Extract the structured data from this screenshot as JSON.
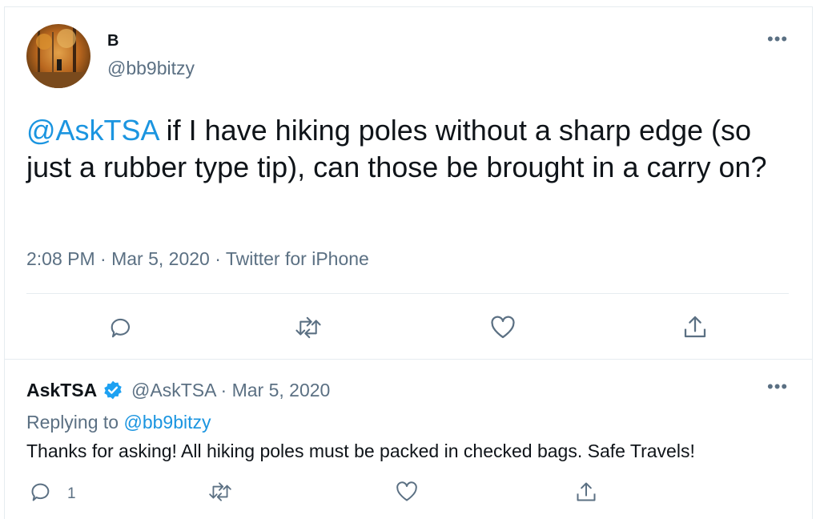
{
  "tweet": {
    "display_name": "B",
    "handle": "@bb9bitzy",
    "mention": "@AskTSA",
    "text": " if I have hiking poles without a sharp edge (so just a rubber type tip), can those be brought in a carry on?",
    "timestamp": "2:08 PM · Mar 5, 2020 · Twitter for iPhone",
    "more_icon": "more-horizontal-icon",
    "actions": [
      "reply-icon",
      "retweet-icon",
      "like-icon",
      "share-icon"
    ]
  },
  "reply": {
    "display_name": "AskTSA",
    "handle_date": "@AskTSA · Mar 5, 2020",
    "replying_prefix": "Replying to ",
    "replying_to": "@bb9bitzy",
    "text": "Thanks for asking! All hiking poles must be packed in checked bags. Safe Travels!",
    "reply_count": "1",
    "actions": [
      "reply-icon",
      "retweet-icon",
      "like-icon",
      "share-icon"
    ]
  },
  "colors": {
    "link": "#1b95e0",
    "secondary_text": "#5b7083",
    "icon": "#5b7083",
    "verified": "#1da1f2",
    "divider": "#e6ecf0"
  }
}
